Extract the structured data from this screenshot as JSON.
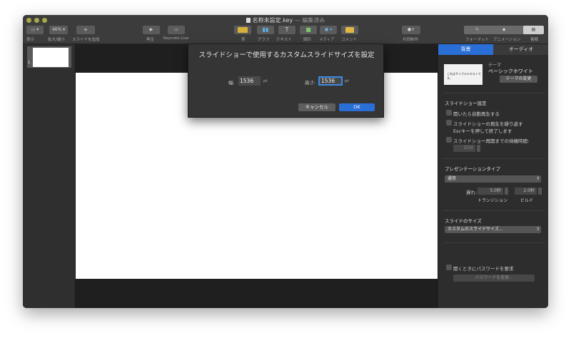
{
  "window": {
    "title": "名称未設定.key",
    "title_sep": " — ",
    "title_status": "編集済み"
  },
  "toolbar": {
    "zoom_value": "46%",
    "labels": {
      "view": "表示",
      "zoom": "拡大/縮小",
      "add_slide": "スライドを追加",
      "play": "再生",
      "keynote_live": "Keynote Live",
      "table": "表",
      "chart": "グラフ",
      "text": "テキスト",
      "shape": "図形",
      "media": "メディア",
      "comment": "コメント",
      "collaborate": "共同制作",
      "format": "フォーマット",
      "animate": "アニメーション",
      "document": "書類"
    }
  },
  "navigator": {
    "slides": [
      {
        "number": "1"
      }
    ]
  },
  "sheet": {
    "title": "スライドショーで使用するカスタムスライドサイズを設定",
    "width_label": "幅:",
    "width_value": "1536",
    "height_label": "高さ:",
    "height_value": "1536",
    "unit": "pt",
    "cancel_label": "キャンセル",
    "ok_label": "OK"
  },
  "inspector": {
    "tabs": {
      "background": "背景",
      "audio": "オーディオ"
    },
    "theme": {
      "thumb_text": "これはサンプルテキストです。",
      "caption": "テーマ",
      "name": "ベーシックホワイト",
      "change_button": "テーマの変更"
    },
    "slideshow": {
      "heading": "スライドショー設定",
      "autoplay": "開いたら自動再生する",
      "loop_line1": "スライドショーの再生を繰り返す",
      "loop_line2": "Escキーを押して終了します",
      "restart": "スライドショー再開までの待機時間:",
      "restart_value": "15分"
    },
    "presentation": {
      "heading": "プレゼンテーションタイプ",
      "type_value": "通常",
      "delay_label": "遅れ:",
      "transition_value": "5.0秒",
      "build_value": "2.0秒",
      "transition_label": "トランジション",
      "build_label": "ビルド"
    },
    "slide_size": {
      "heading": "スライドのサイズ",
      "value": "カスタムのスライドサイズ..."
    },
    "password": {
      "require": "開くときにパスワードを要求",
      "change_button": "パスワードを変更..."
    }
  },
  "colors": {
    "accent": "#2a6fd6",
    "traffic_light": "#a9a94a"
  }
}
